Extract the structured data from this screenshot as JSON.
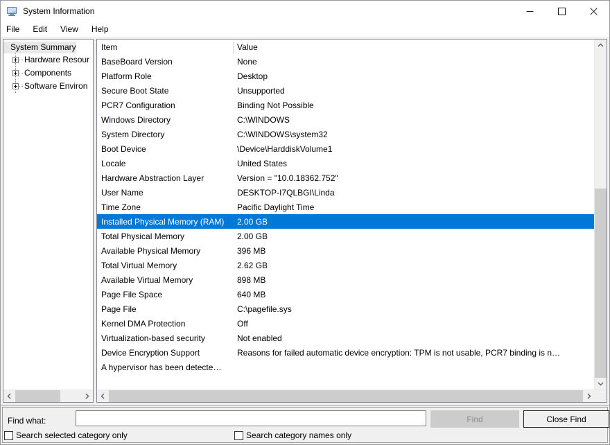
{
  "window": {
    "title": "System Information",
    "icon": "computer-icon",
    "controls": {
      "minimize": "minimize-icon",
      "maximize": "maximize-icon",
      "close": "close-icon"
    }
  },
  "menubar": {
    "items": [
      {
        "label": "File"
      },
      {
        "label": "Edit"
      },
      {
        "label": "View"
      },
      {
        "label": "Help"
      }
    ]
  },
  "tree": {
    "root": {
      "label": "System Summary",
      "selected": true
    },
    "nodes": [
      {
        "label": "Hardware Resour",
        "expander": "plus-icon"
      },
      {
        "label": "Components",
        "expander": "plus-icon"
      },
      {
        "label": "Software Environ",
        "expander": "plus-icon"
      }
    ]
  },
  "list": {
    "columns": {
      "item": "Item",
      "value": "Value"
    },
    "rows": [
      {
        "item": "BaseBoard Version",
        "value": "None"
      },
      {
        "item": "Platform Role",
        "value": "Desktop"
      },
      {
        "item": "Secure Boot State",
        "value": "Unsupported"
      },
      {
        "item": "PCR7 Configuration",
        "value": "Binding Not Possible"
      },
      {
        "item": "Windows Directory",
        "value": "C:\\WINDOWS"
      },
      {
        "item": "System Directory",
        "value": "C:\\WINDOWS\\system32"
      },
      {
        "item": "Boot Device",
        "value": "\\Device\\HarddiskVolume1"
      },
      {
        "item": "Locale",
        "value": "United States"
      },
      {
        "item": "Hardware Abstraction Layer",
        "value": "Version = \"10.0.18362.752\""
      },
      {
        "item": "User Name",
        "value": "DESKTOP-I7QLBGI\\Linda"
      },
      {
        "item": "Time Zone",
        "value": "Pacific Daylight Time"
      },
      {
        "item": "Installed Physical Memory (RAM)",
        "value": "2.00 GB",
        "selected": true
      },
      {
        "item": "Total Physical Memory",
        "value": "2.00 GB"
      },
      {
        "item": "Available Physical Memory",
        "value": "396 MB"
      },
      {
        "item": "Total Virtual Memory",
        "value": "2.62 GB"
      },
      {
        "item": "Available Virtual Memory",
        "value": "898 MB"
      },
      {
        "item": "Page File Space",
        "value": "640 MB"
      },
      {
        "item": "Page File",
        "value": "C:\\pagefile.sys"
      },
      {
        "item": "Kernel DMA Protection",
        "value": "Off"
      },
      {
        "item": "Virtualization-based security",
        "value": "Not enabled"
      },
      {
        "item": "Device Encryption Support",
        "value": "Reasons for failed automatic device encryption: TPM is not usable, PCR7 binding is n…"
      },
      {
        "item": "A hypervisor has been detecte…",
        "value": "",
        "wide": true
      }
    ]
  },
  "findbar": {
    "label": "Find what:",
    "input_value": "",
    "input_placeholder": "",
    "find_button": "Find",
    "close_find_button": "Close Find",
    "checkbox_selected_category": "Search selected category only",
    "checkbox_category_names": "Search category names only"
  },
  "colors": {
    "selection_blue": "#0078d7",
    "window_bg": "#f0f0f0",
    "panel_bg": "#ffffff",
    "scroll_thumb": "#cdcdcd",
    "disabled_button": "#cccccc"
  }
}
